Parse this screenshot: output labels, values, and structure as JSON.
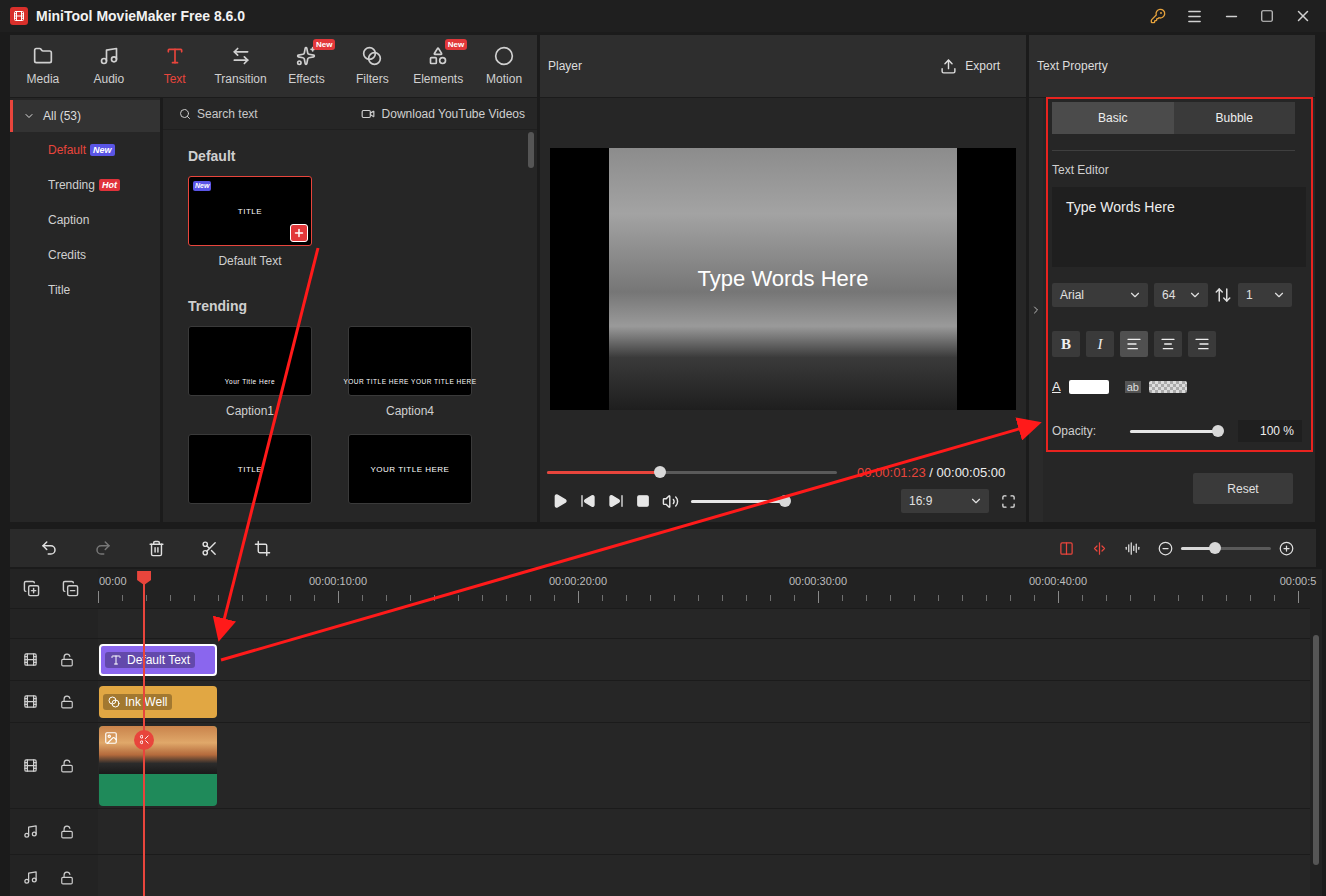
{
  "window": {
    "title": "MiniTool MovieMaker Free 8.6.0"
  },
  "toolbar": [
    {
      "label": "Media",
      "selected": false,
      "badge": ""
    },
    {
      "label": "Audio",
      "selected": false,
      "badge": ""
    },
    {
      "label": "Text",
      "selected": true,
      "badge": ""
    },
    {
      "label": "Transition",
      "selected": false,
      "badge": ""
    },
    {
      "label": "Effects",
      "selected": false,
      "badge": "New"
    },
    {
      "label": "Filters",
      "selected": false,
      "badge": ""
    },
    {
      "label": "Elements",
      "selected": false,
      "badge": "New"
    },
    {
      "label": "Motion",
      "selected": false,
      "badge": ""
    }
  ],
  "library": {
    "group": {
      "label": "All (53)",
      "expanded": true
    },
    "categories": [
      {
        "label": "Default",
        "selected": true,
        "badge": {
          "text": "New",
          "color": "#5a55e6"
        }
      },
      {
        "label": "Trending",
        "selected": false,
        "badge": {
          "text": "Hot",
          "color": "#e0323a"
        }
      },
      {
        "label": "Caption",
        "selected": false,
        "badge": null
      },
      {
        "label": "Credits",
        "selected": false,
        "badge": null
      },
      {
        "label": "Title",
        "selected": false,
        "badge": null
      }
    ],
    "search": {
      "placeholder": "Search text"
    },
    "download": "Download YouTube Videos",
    "sections": [
      {
        "title": "Default",
        "cards": [
          {
            "kind": "title",
            "preview": "TITLE",
            "label": "Default Text",
            "selected": true,
            "badge": "New"
          }
        ]
      },
      {
        "title": "Trending",
        "cards": [
          {
            "kind": "caption",
            "preview": "Your Title Here",
            "label": "Caption1",
            "selected": false,
            "badge": ""
          },
          {
            "kind": "caption",
            "preview": "YOUR TITLE HERE YOUR TITLE HERE",
            "label": "Caption4",
            "selected": false,
            "badge": ""
          },
          {
            "kind": "title",
            "preview": "TITLE",
            "label": "",
            "selected": false,
            "badge": ""
          },
          {
            "kind": "title",
            "preview": "YOUR TITLE HERE",
            "label": "",
            "selected": false,
            "badge": ""
          }
        ]
      }
    ]
  },
  "player": {
    "title": "Player",
    "export": "Export",
    "overlay_text": "Type Words Here",
    "progress": {
      "level": 0.39
    },
    "current_time": "00:00:01:23",
    "separator": "/",
    "total_time": "00:00:05:00",
    "playing": false,
    "volume": {
      "level": 1
    },
    "aspect": "16:9"
  },
  "properties": {
    "title": "Text Property",
    "tabs": [
      {
        "label": "Basic",
        "selected": true
      },
      {
        "label": "Bubble",
        "selected": false
      }
    ],
    "editor_label": "Text Editor",
    "text": "Type Words Here",
    "font": "Arial",
    "size": "64",
    "line_spacing": "1",
    "styles": [
      {
        "label": "B",
        "kind": "bold",
        "selected": false
      },
      {
        "label": "I",
        "kind": "italic",
        "selected": false
      }
    ],
    "alignment": [
      {
        "kind": "left",
        "selected": true
      },
      {
        "kind": "center",
        "selected": false
      },
      {
        "kind": "right",
        "selected": false
      }
    ],
    "text_color": {
      "label": "A",
      "color": "#ffffff"
    },
    "background_color": {
      "label": "ab",
      "transparent": true
    },
    "opacity": {
      "label": "Opacity:",
      "level": 1,
      "reading": "100 %"
    },
    "reset": "Reset"
  },
  "timeline": {
    "ruler": [
      "00:00",
      "00:00:10:00",
      "00:00:20:00",
      "00:00:30:00",
      "00:00:40:00",
      "00:00:5"
    ],
    "playhead_seconds": 1.92,
    "zoom": {
      "level": 0.38
    },
    "tracks": [
      {
        "kind": "text",
        "locked": false,
        "clip": {
          "label": "Default Text",
          "seconds": 5,
          "selected": true
        }
      },
      {
        "kind": "filter",
        "locked": false,
        "clip": {
          "label": "Ink Well",
          "seconds": 5,
          "selected": false
        }
      },
      {
        "kind": "video",
        "locked": false,
        "clip": {
          "label": "",
          "seconds": 5,
          "selected": false
        }
      },
      {
        "kind": "audio",
        "locked": false,
        "clip": null
      },
      {
        "kind": "audio",
        "locked": false,
        "clip": null
      }
    ]
  }
}
